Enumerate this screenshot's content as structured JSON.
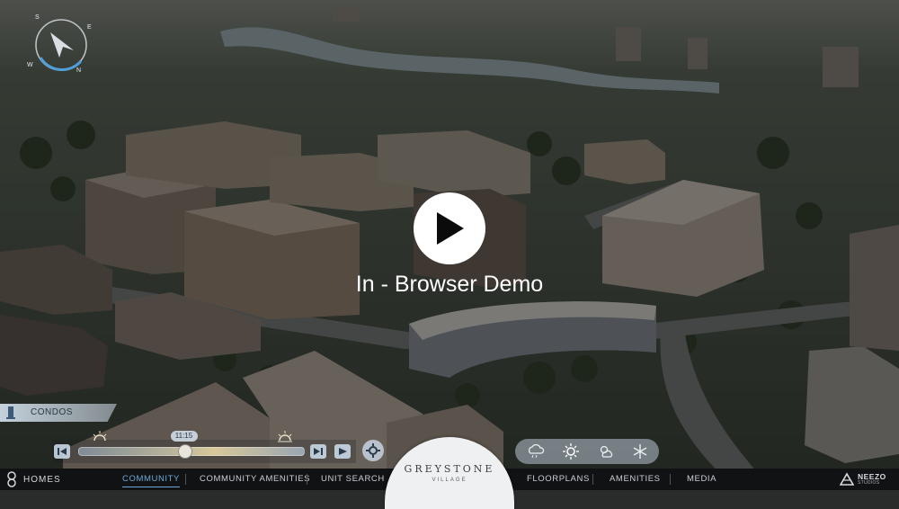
{
  "hero": {
    "play_label": "In - Browser Demo"
  },
  "compass": {
    "n": "N",
    "s": "S",
    "e": "E",
    "w": "W"
  },
  "location_tag": {
    "label": "CONDOS"
  },
  "timeline": {
    "time": "11:15",
    "progress": 0.47
  },
  "brand": {
    "left": "HOMES",
    "project_title": "GREYSTONE",
    "project_sub": "VILLAGE",
    "right_name": "NEEZO",
    "right_sub": "STUDIOS"
  },
  "nav": {
    "items": [
      "COMMUNITY",
      "COMMUNITY AMENITIES",
      "UNIT SEARCH",
      "FLOORPLANS",
      "AMENITIES",
      "MEDIA"
    ],
    "active": "COMMUNITY"
  },
  "colors": {
    "accent": "#6fa8d8",
    "nav_bg": "#101214",
    "play_bg": "#ffffff"
  },
  "icons": {
    "timeline_start": "skip-back-icon",
    "timeline_end": "skip-forward-icon",
    "play_small": "play-icon",
    "settings": "gear-icon",
    "weather": [
      "cloud-rain-icon",
      "sun-icon",
      "cloudy-sun-icon",
      "snowflake-icon"
    ]
  }
}
